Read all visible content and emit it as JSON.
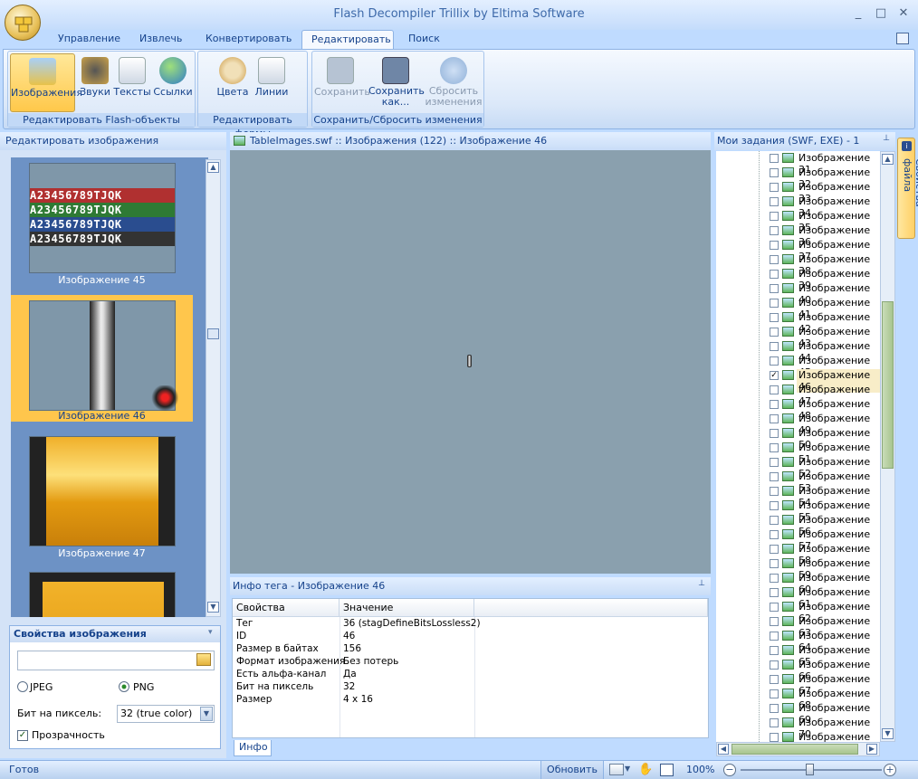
{
  "window": {
    "title": "Flash Decompiler Trillix by Eltima Software",
    "min": "_",
    "max": "□",
    "close": "✕"
  },
  "tabs": [
    {
      "label": "Управление"
    },
    {
      "label": "Извлечь"
    },
    {
      "label": "Конвертировать"
    },
    {
      "label": "Редактировать"
    },
    {
      "label": "Поиск"
    }
  ],
  "ribbon": {
    "groups": [
      {
        "label": "Редактировать Flash-объекты",
        "buttons": [
          "Изображения",
          "Звуки",
          "Тексты",
          "Ссылки"
        ]
      },
      {
        "label": "Редактировать формы",
        "buttons": [
          "Цвета",
          "Линии"
        ]
      },
      {
        "label": "Сохранить/Сбросить изменения",
        "buttons": [
          "Сохранить",
          "Сохранить как...",
          "Сбросить изменения"
        ]
      }
    ]
  },
  "left_panel": {
    "title": "Редактировать изображения",
    "thumbnails": [
      {
        "label": "Изображение 45"
      },
      {
        "label": "Изображение 46"
      },
      {
        "label": "Изображение 47"
      }
    ],
    "card_rows": [
      "A23456789TJQK",
      "A23456789TJQK",
      "A23456789TJQK",
      "A23456789TJQK"
    ],
    "image_props": {
      "title": "Свойства изображения",
      "file_value": "",
      "jpeg_label": "JPEG",
      "png_label": "PNG",
      "bits_label": "Бит на пиксель:",
      "bits_value": "32 (true color)",
      "transparency_label": "Прозрачность"
    }
  },
  "viewer": {
    "path": "TableImages.swf :: Изображения (122) :: Изображение 46"
  },
  "info": {
    "title": "Инфо тега - Изображение 46",
    "columns": [
      "Свойства",
      "Значение"
    ],
    "rows": [
      [
        "Тег",
        "36 (stagDefineBitsLossless2)"
      ],
      [
        "ID",
        "46"
      ],
      [
        "Размер в байтах",
        "156"
      ],
      [
        "Формат изображения",
        "Без потерь"
      ],
      [
        "Есть альфа-канал",
        "Да"
      ],
      [
        "Бит на пиксель",
        "32"
      ],
      [
        "Размер",
        "4 x 16"
      ]
    ],
    "tab": "Инфо"
  },
  "right_panel": {
    "title": "Мои задания (SWF, EXE) - 1",
    "items": [
      "Изображение 31",
      "Изображение 32",
      "Изображение 33",
      "Изображение 34",
      "Изображение 35",
      "Изображение 36",
      "Изображение 37",
      "Изображение 38",
      "Изображение 39",
      "Изображение 40",
      "Изображение 41",
      "Изображение 42",
      "Изображение 43",
      "Изображение 44",
      "Изображение 45",
      "Изображение 46",
      "Изображение 47",
      "Изображение 48",
      "Изображение 49",
      "Изображение 50",
      "Изображение 51",
      "Изображение 52",
      "Изображение 53",
      "Изображение 54",
      "Изображение 55",
      "Изображение 56",
      "Изображение 57",
      "Изображение 58",
      "Изображение 59",
      "Изображение 60",
      "Изображение 61",
      "Изображение 62",
      "Изображение 63",
      "Изображение 64",
      "Изображение 65",
      "Изображение 66",
      "Изображение 67",
      "Изображение 68",
      "Изображение 69",
      "Изображение 70",
      "Изображение 71"
    ],
    "selected": "Изображение 46",
    "side_tab": "Свойства файла"
  },
  "status": {
    "text": "Готов",
    "refresh": "Обновить",
    "zoom": "100%"
  }
}
